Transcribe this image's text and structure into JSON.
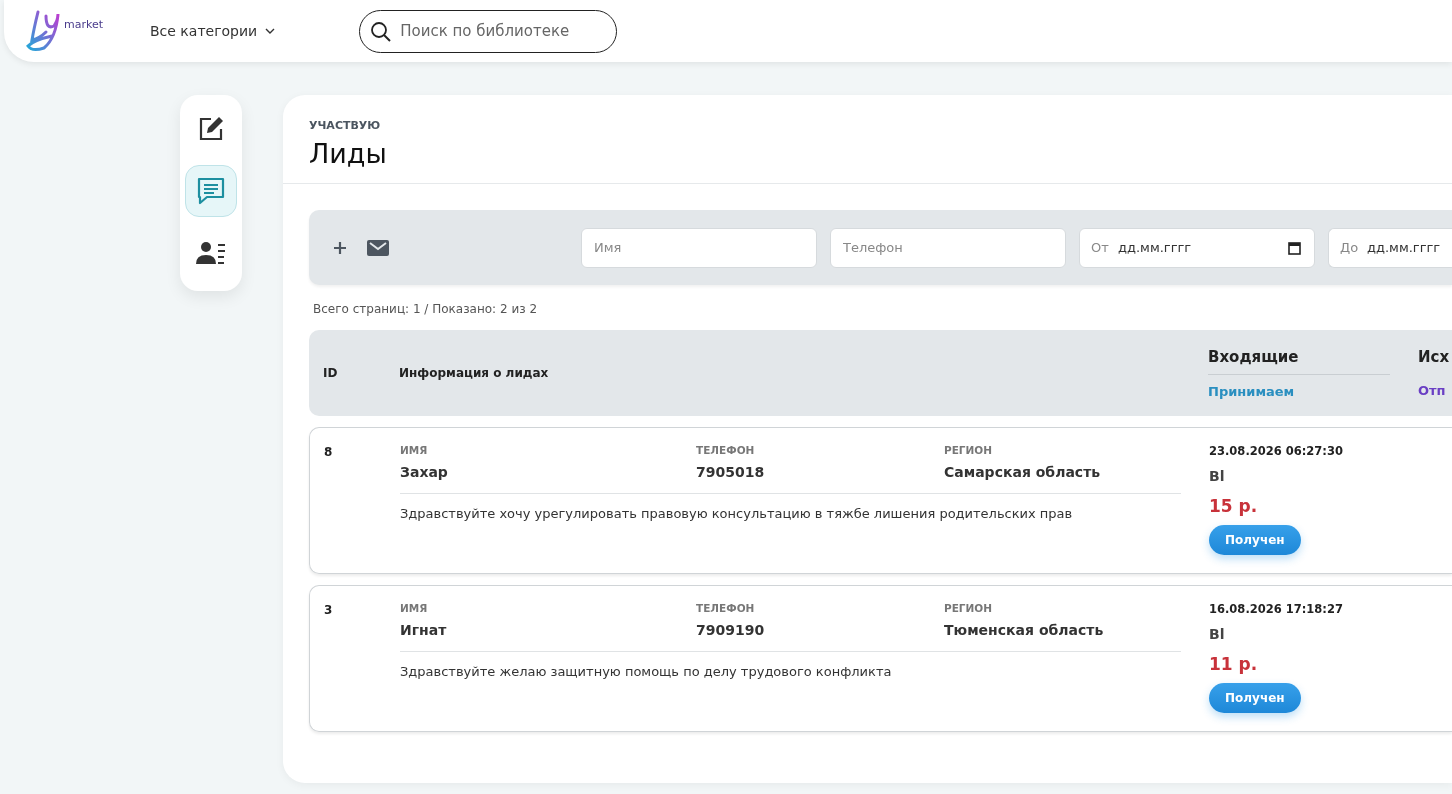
{
  "topbar": {
    "logo_text": "market",
    "categories": "Все категории",
    "search": {
      "placeholder": "Поиск по библиотеке"
    }
  },
  "sidebar": {
    "items": [
      {
        "kind": "edit",
        "selected": false
      },
      {
        "kind": "messages",
        "selected": true
      },
      {
        "kind": "contacts",
        "selected": false
      }
    ]
  },
  "page": {
    "overline": "УЧАСТВУЮ",
    "title": "Лиды"
  },
  "filters": {
    "name": {
      "placeholder": "Имя"
    },
    "phone": {
      "placeholder": "Телефон"
    },
    "from": {
      "label": "От",
      "placeholder": "дд.мм.гггг"
    },
    "to": {
      "label": "До",
      "placeholder": "дд.мм.гггг"
    }
  },
  "summary": "Всего страниц: 1 / Показано: 2 из 2",
  "table": {
    "columns": [
      {
        "title": "ID"
      },
      {
        "title": "Информация о лидах"
      },
      {
        "title": "Входящие",
        "sub": "Принимаем"
      },
      {
        "title": "Исх",
        "sub": "Отп"
      }
    ],
    "rows": [
      {
        "id": "8",
        "name_label": "ИМЯ",
        "name": "Захар",
        "phone_label": "ТЕЛЕФОН",
        "phone": "7905018",
        "region_label": "РЕГИОН",
        "region": "Самарская область",
        "message": "Здравствуйте хочу урегулировать правовую консультацию в тяжбе лишения родительских прав",
        "date": "23.08.2026 06:27:30",
        "code": "Bl",
        "price": "15 р.",
        "status": "Получен"
      },
      {
        "id": "3",
        "name_label": "ИМЯ",
        "name": "Игнат",
        "phone_label": "ТЕЛЕФОН",
        "phone": "7909190",
        "region_label": "РЕГИОН",
        "region": "Тюменская область",
        "message": "Здравствуйте желаю защитную помощь по делу трудового конфликта",
        "date": "16.08.2026 17:18:27",
        "code": "Bl",
        "price": "11 р.",
        "status": "Получен"
      }
    ]
  }
}
